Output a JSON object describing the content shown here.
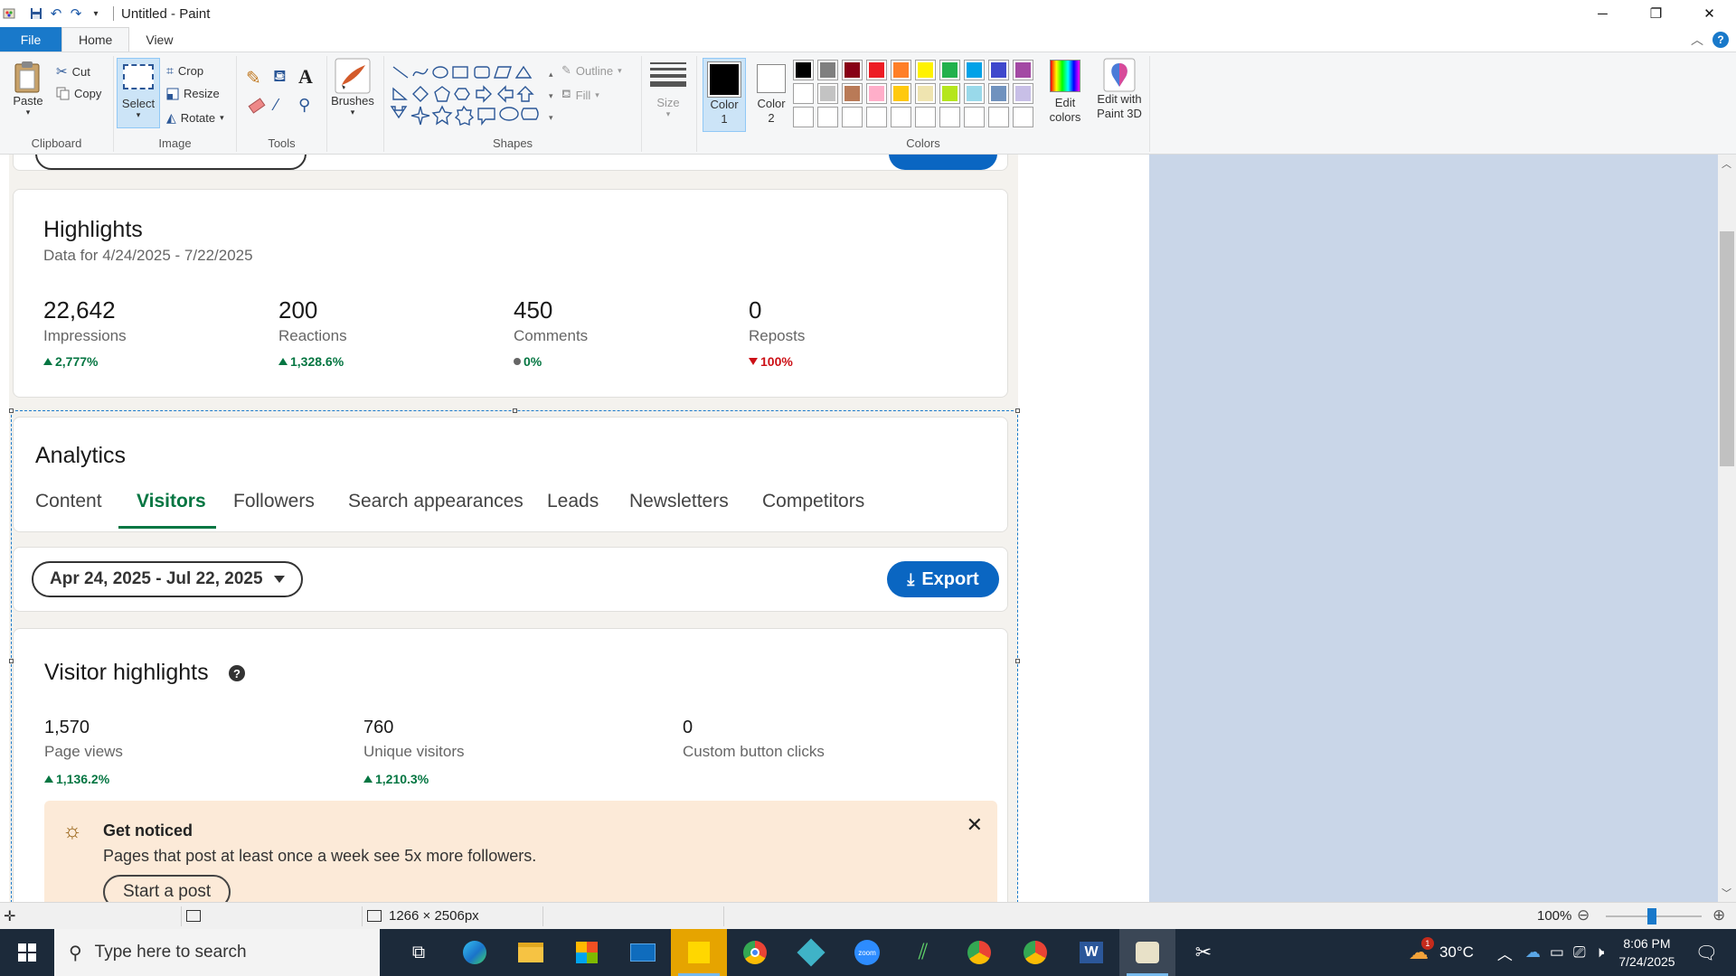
{
  "window": {
    "title": "Untitled - Paint",
    "minimize": "─",
    "maximize": "❐",
    "close": "✕"
  },
  "ribbon_tabs": {
    "file": "File",
    "home": "Home",
    "view": "View"
  },
  "clipboard": {
    "paste": "Paste",
    "cut": "Cut",
    "copy": "Copy",
    "label": "Clipboard"
  },
  "image_group": {
    "select": "Select",
    "crop": "Crop",
    "resize": "Resize",
    "rotate": "Rotate",
    "label": "Image"
  },
  "tools_group": {
    "label": "Tools"
  },
  "brushes": {
    "label": "Brushes"
  },
  "shapes_group": {
    "outline": "Outline",
    "fill": "Fill",
    "label": "Shapes"
  },
  "size": {
    "label": "Size"
  },
  "colors_group": {
    "color1": "Color 1",
    "color2": "Color 2",
    "edit_colors": "Edit colors",
    "edit_3d": "Edit with Paint 3D",
    "label": "Colors",
    "color1_value": "#000000",
    "color2_value": "#ffffff",
    "palette_row1": [
      "#000000",
      "#7f7f7f",
      "#880015",
      "#ed1c24",
      "#ff7f27",
      "#fff200",
      "#22b14c",
      "#00a2e8",
      "#3f48cc",
      "#a349a4"
    ],
    "palette_row2": [
      "#ffffff",
      "#c3c3c3",
      "#b97a57",
      "#ffaec9",
      "#ffc90e",
      "#efe4b0",
      "#b5e61d",
      "#99d9ea",
      "#7092be",
      "#c8bfe7"
    ],
    "palette_row3": [
      "#ffffff",
      "#ffffff",
      "#ffffff",
      "#ffffff",
      "#ffffff",
      "#ffffff",
      "#ffffff",
      "#ffffff",
      "#ffffff",
      "#ffffff"
    ]
  },
  "highlights": {
    "title": "Highlights",
    "date_range": "Data for 4/24/2025 - 7/22/2025",
    "metrics": [
      {
        "value": "22,642",
        "label": "Impressions",
        "delta": "2,777%",
        "trend": "up"
      },
      {
        "value": "200",
        "label": "Reactions",
        "delta": "1,328.6%",
        "trend": "up"
      },
      {
        "value": "450",
        "label": "Comments",
        "delta": "0%",
        "trend": "neutral"
      },
      {
        "value": "0",
        "label": "Reposts",
        "delta": "100%",
        "trend": "down"
      }
    ]
  },
  "analytics": {
    "title": "Analytics",
    "tabs": [
      "Content",
      "Visitors",
      "Followers",
      "Search appearances",
      "Leads",
      "Newsletters",
      "Competitors"
    ],
    "active_tab": "Visitors"
  },
  "filters": {
    "date_range": "Apr 24, 2025 - Jul 22, 2025",
    "export": "Export"
  },
  "visitor_highlights": {
    "title": "Visitor highlights",
    "metrics": [
      {
        "value": "1,570",
        "label": "Page views",
        "delta": "1,136.2%"
      },
      {
        "value": "760",
        "label": "Unique visitors",
        "delta": "1,210.3%"
      },
      {
        "value": "0",
        "label": "Custom button clicks",
        "delta": ""
      }
    ]
  },
  "notice": {
    "title": "Get noticed",
    "body": "Pages that post at least once a week see 5x more followers.",
    "cta": "Start a post"
  },
  "statusbar": {
    "dimensions": "1266 × 2506px",
    "zoom": "100%"
  },
  "taskbar": {
    "search_placeholder": "Type here to search",
    "weather": "30°C",
    "time": "8:06 PM",
    "date": "7/24/2025",
    "weather_badge": "1"
  }
}
